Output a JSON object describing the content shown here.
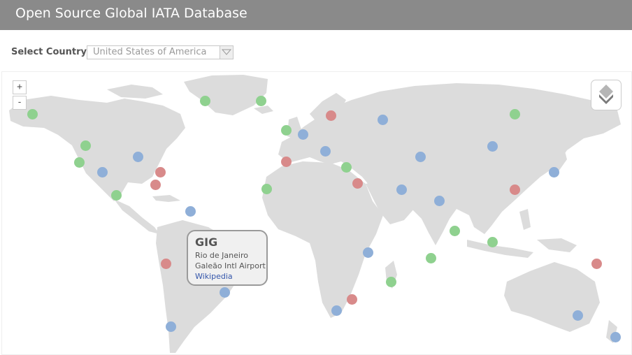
{
  "header": {
    "title": "Open Source Global IATA Database"
  },
  "toolbar": {
    "country_label": "Select Country",
    "country_value": "United States of America"
  },
  "map": {
    "zoom_in": "+",
    "zoom_out": "-",
    "colors": {
      "land": "#dcdcdc",
      "green": "#8fd18f",
      "blue": "#8fafd8",
      "red": "#d88a8a"
    },
    "popup": {
      "code": "GIG",
      "city": "Rio de Janeiro",
      "airport": "Galeão Intl Airport",
      "link": "Wikipedia"
    }
  }
}
